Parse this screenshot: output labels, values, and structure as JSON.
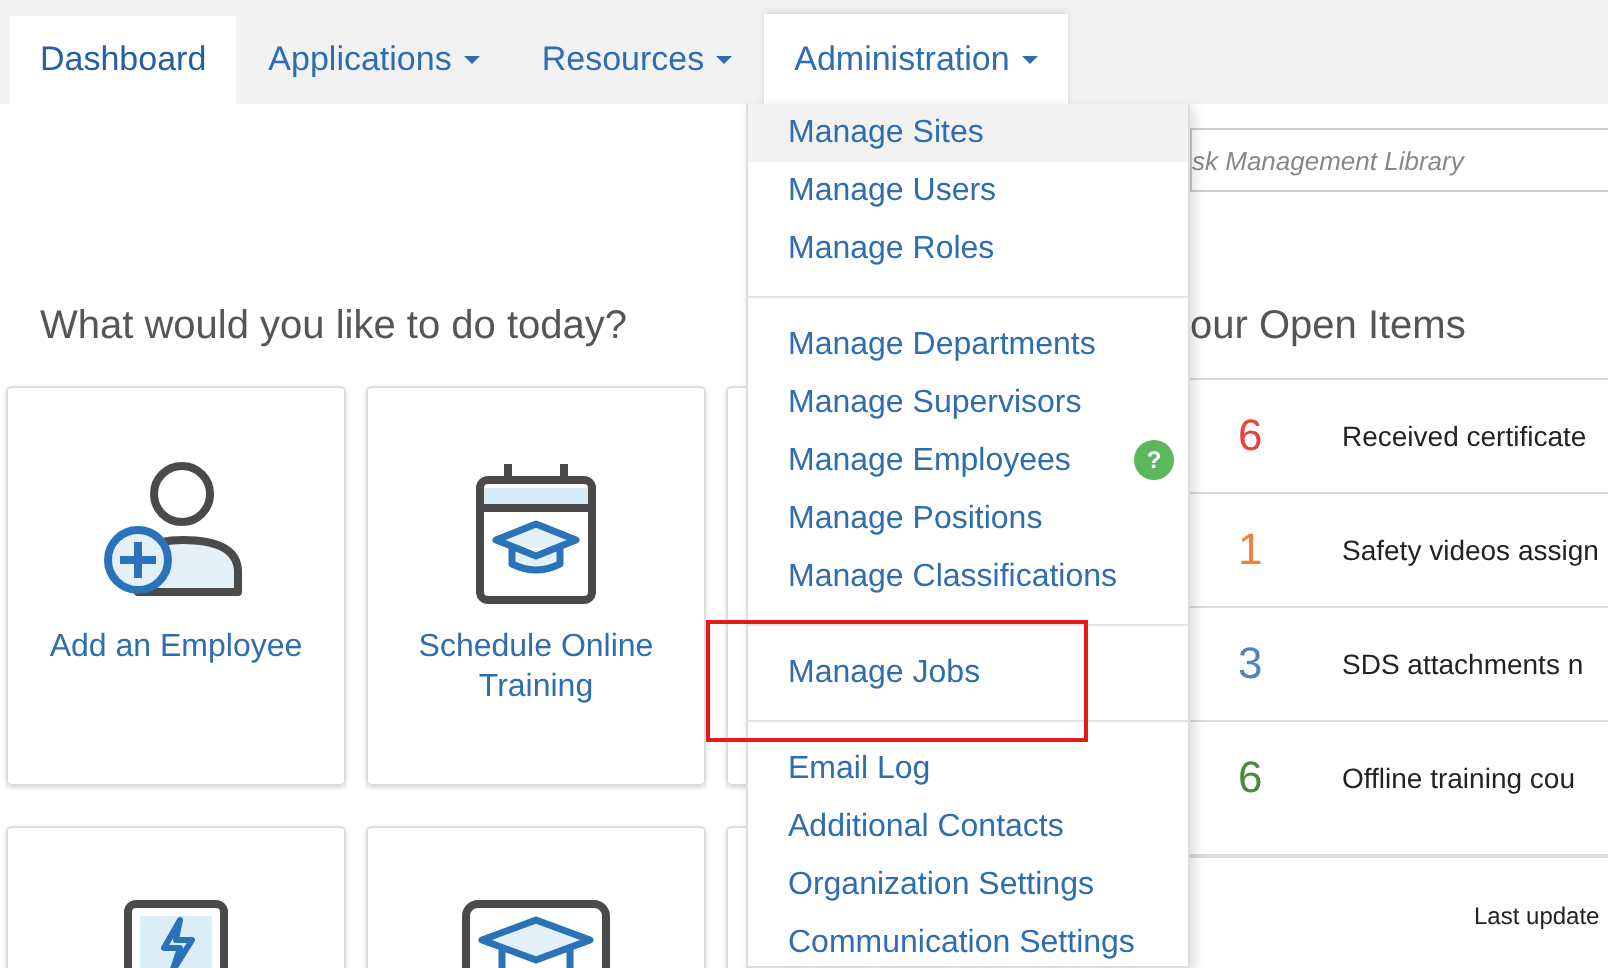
{
  "nav": {
    "tabs": [
      {
        "label": "Dashboard",
        "selected": true,
        "dropdown": false,
        "expanded": false
      },
      {
        "label": "Applications",
        "selected": false,
        "dropdown": true,
        "expanded": false
      },
      {
        "label": "Resources",
        "selected": false,
        "dropdown": true,
        "expanded": false
      },
      {
        "label": "Administration",
        "selected": false,
        "dropdown": true,
        "expanded": true
      }
    ]
  },
  "admin_menu": {
    "groups": [
      [
        {
          "label": "Manage Sites",
          "selected": true,
          "annotated": false
        },
        {
          "label": "Manage Users",
          "selected": false,
          "annotated": false
        },
        {
          "label": "Manage Roles",
          "selected": false,
          "annotated": false
        }
      ],
      [
        {
          "label": "Manage Departments",
          "selected": false,
          "annotated": false
        },
        {
          "label": "Manage Supervisors",
          "selected": false,
          "annotated": false
        },
        {
          "label": "Manage Employees",
          "selected": false,
          "annotated": false,
          "badge": "?"
        },
        {
          "label": "Manage Positions",
          "selected": false,
          "annotated": false
        },
        {
          "label": "Manage Classifications",
          "selected": false,
          "annotated": false
        }
      ],
      [
        {
          "label": "Manage Jobs",
          "selected": false,
          "annotated": true
        }
      ],
      [
        {
          "label": "Email Log",
          "selected": false,
          "annotated": false
        },
        {
          "label": "Additional Contacts",
          "selected": false,
          "annotated": false
        },
        {
          "label": "Organization Settings",
          "selected": false,
          "annotated": false
        },
        {
          "label": "Communication Settings",
          "selected": false,
          "annotated": false
        }
      ]
    ]
  },
  "tasks": {
    "heading": "What would you like to do today?",
    "cards": [
      {
        "kind": "person",
        "label": "Add an Employee"
      },
      {
        "kind": "calendar",
        "label": "Schedule Online Training"
      },
      {
        "kind": "blank"
      },
      {
        "kind": "tablet"
      },
      {
        "kind": "screen"
      },
      {
        "kind": "blank"
      }
    ]
  },
  "search": {
    "placeholder": "sk Management Library"
  },
  "open_items": {
    "heading": "our Open Items",
    "items": [
      {
        "count": "6",
        "text": "Received certificate",
        "color": "#e8453c"
      },
      {
        "count": "1",
        "text": "Safety videos assign",
        "color": "#f0803c"
      },
      {
        "count": "3",
        "text": "SDS attachments n",
        "color": "#4a86c5"
      },
      {
        "count": "6",
        "text": "Offline training cou",
        "color": "#4a8a3a"
      }
    ],
    "footer": "Last update"
  }
}
